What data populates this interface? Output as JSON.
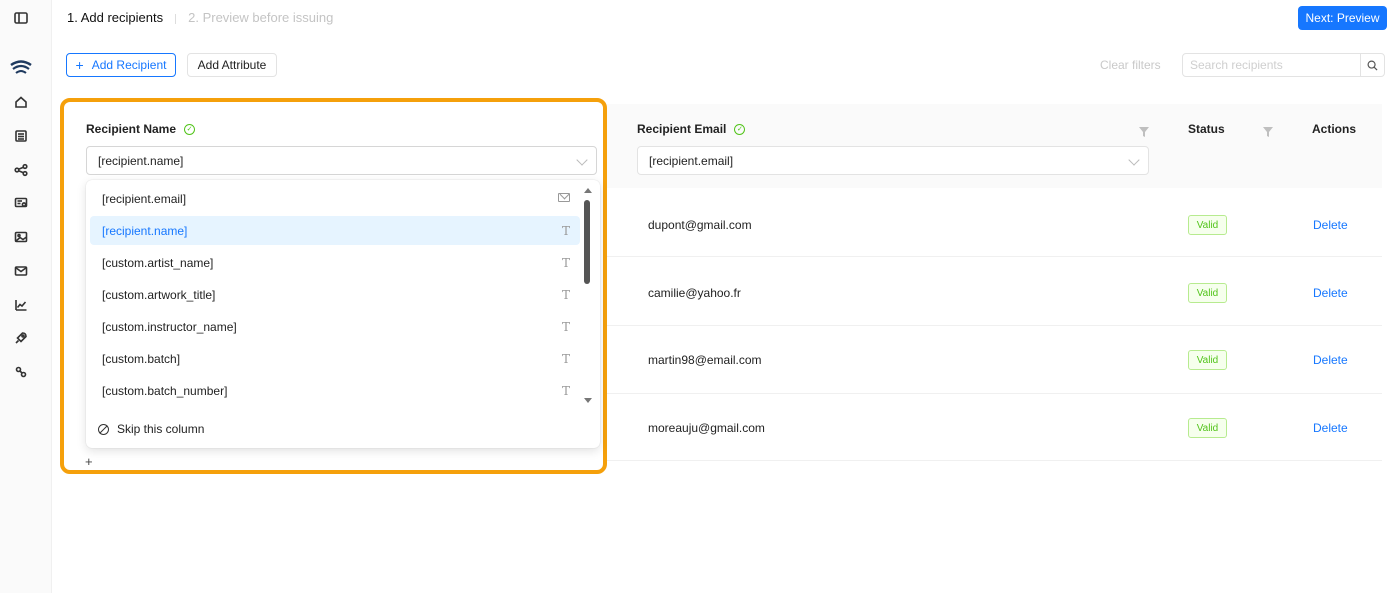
{
  "header": {
    "step1": "1. Add recipients",
    "step2": "2. Preview before issuing",
    "next_label": "Next: Preview"
  },
  "toolbar": {
    "add_recipient": "Add Recipient",
    "add_attribute": "Add Attribute",
    "clear_filters": "Clear filters",
    "search_placeholder": "Search recipients"
  },
  "table": {
    "columns": {
      "name": "Recipient Name",
      "email": "Recipient Email",
      "status": "Status",
      "actions": "Actions"
    },
    "name_select_value": "[recipient.name]",
    "email_select_value": "[recipient.email]",
    "rows": [
      {
        "email": "dupont@gmail.com",
        "status": "Valid",
        "action": "Delete"
      },
      {
        "email": "camilie@yahoo.fr",
        "status": "Valid",
        "action": "Delete"
      },
      {
        "email": "martin98@email.com",
        "status": "Valid",
        "action": "Delete"
      },
      {
        "email": "moreauju@gmail.com",
        "status": "Valid",
        "action": "Delete"
      }
    ]
  },
  "dropdown": {
    "options": [
      {
        "label": "[recipient.email]",
        "type": "mail-icon"
      },
      {
        "label": "[recipient.name]",
        "type": "text-type-icon",
        "selected": true
      },
      {
        "label": "[custom.artist_name]",
        "type": "text-type-icon"
      },
      {
        "label": "[custom.artwork_title]",
        "type": "text-type-icon"
      },
      {
        "label": "[custom.instructor_name]",
        "type": "text-type-icon"
      },
      {
        "label": "[custom.batch]",
        "type": "text-type-icon"
      },
      {
        "label": "[custom.batch_number]",
        "type": "text-type-icon"
      }
    ],
    "skip_label": "Skip this column"
  },
  "add_row_symbol": "+",
  "type_glyph": "T",
  "colors": {
    "primary": "#1677ff",
    "highlight": "#f5a00b",
    "valid": "#52c41a"
  }
}
